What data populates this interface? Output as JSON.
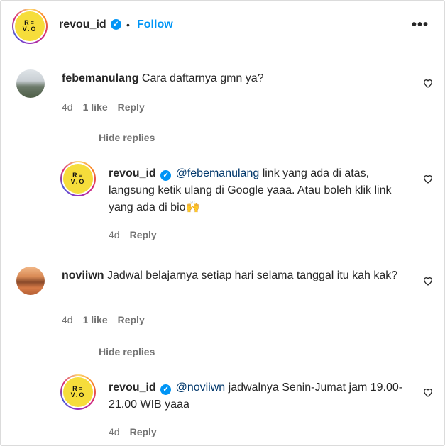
{
  "header": {
    "username": "revou_id",
    "dot": "•",
    "follow_label": "Follow",
    "more_label": "•••",
    "logo_top": "R≡",
    "logo_bottom": "V.O"
  },
  "comments": [
    {
      "username": "febemanulang",
      "text": "Cara daftarnya gmn ya?",
      "time": "4d",
      "likes": "1 like",
      "reply_label": "Reply",
      "hide_replies_label": "Hide replies",
      "reply": {
        "username": "revou_id",
        "mention": "@febemanulang",
        "text": " link yang ada di atas, langsung ketik ulang di Google yaaa. Atau boleh klik link yang ada di bio🙌",
        "time": "4d",
        "reply_label": "Reply"
      }
    },
    {
      "username": "noviiwn",
      "text": "Jadwal belajarnya setiap hari selama tanggal itu kah kak?",
      "time": "4d",
      "likes": "1 like",
      "reply_label": "Reply",
      "hide_replies_label": "Hide replies",
      "reply": {
        "username": "revou_id",
        "mention": "@noviiwn",
        "text": " jadwalnya Senin-Jumat jam 19.00-21.00 WIB yaaa",
        "time": "4d",
        "reply_label": "Reply"
      }
    }
  ],
  "colors": {
    "link_blue": "#0095f6",
    "mention_blue": "#00376b",
    "muted_gray": "#737373",
    "logo_yellow": "#f6dd3b"
  },
  "icons": {
    "verified": "verified-badge-icon",
    "heart": "heart-outline-icon",
    "more": "more-horizontal-icon"
  }
}
